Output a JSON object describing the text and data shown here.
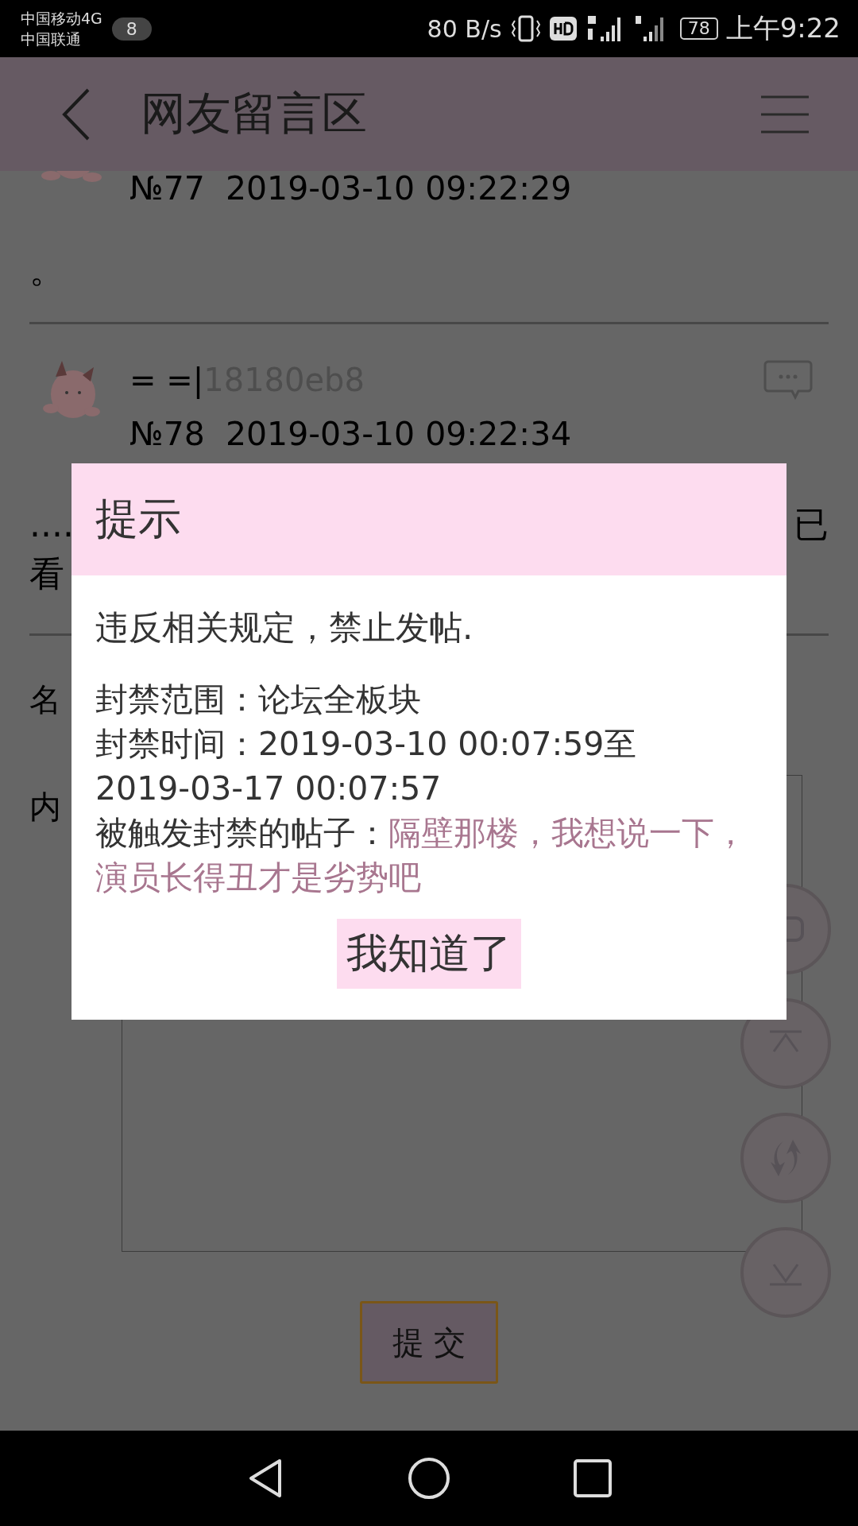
{
  "status_bar": {
    "carrier_1": "中国移动4G",
    "carrier_2": "中国联通",
    "notification_count": "8",
    "net_speed": "80 B/s",
    "battery": "78",
    "time": "上午9:22"
  },
  "header": {
    "title": "网友留言区"
  },
  "posts": [
    {
      "meta": "№77  2019-03-10 09:22:29",
      "body": [
        "。"
      ]
    },
    {
      "name": "= =|",
      "user_id": "18180eb8",
      "meta": "№78  2019-03-10 09:22:34",
      "body_left": "....",
      "body_right": "已",
      "body": [
        "看"
      ]
    }
  ],
  "form": {
    "name_label": "名",
    "content_label": "内",
    "submit": "提 交"
  },
  "dialog": {
    "title": "提示",
    "message": "违反相关规定，禁止发帖.",
    "scope": "封禁范围：论坛全板块",
    "time": "封禁时间：2019-03-10 00:07:59至2019-03-17 00:07:57",
    "trigger_label": "被触发封禁的帖子：",
    "trigger_post": "隔壁那楼，我想说一下，演员长得丑才是劣势吧",
    "confirm": "我知道了"
  }
}
